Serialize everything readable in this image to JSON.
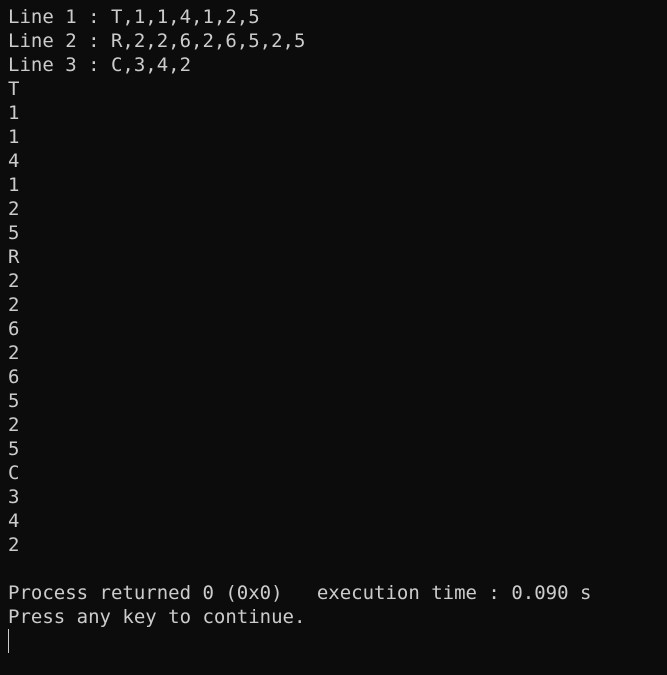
{
  "console": {
    "lines": [
      "Line 1 : T,1,1,4,1,2,5",
      "Line 2 : R,2,2,6,2,6,5,2,5",
      "Line 3 : C,3,4,2",
      "T",
      "1",
      "1",
      "4",
      "1",
      "2",
      "5",
      "R",
      "2",
      "2",
      "6",
      "2",
      "6",
      "5",
      "2",
      "5",
      "C",
      "3",
      "4",
      "2",
      "",
      "Process returned 0 (0x0)   execution time : 0.090 s",
      "Press any key to continue."
    ]
  },
  "colors": {
    "background": "#0c0c0c",
    "text": "#cccccc"
  }
}
